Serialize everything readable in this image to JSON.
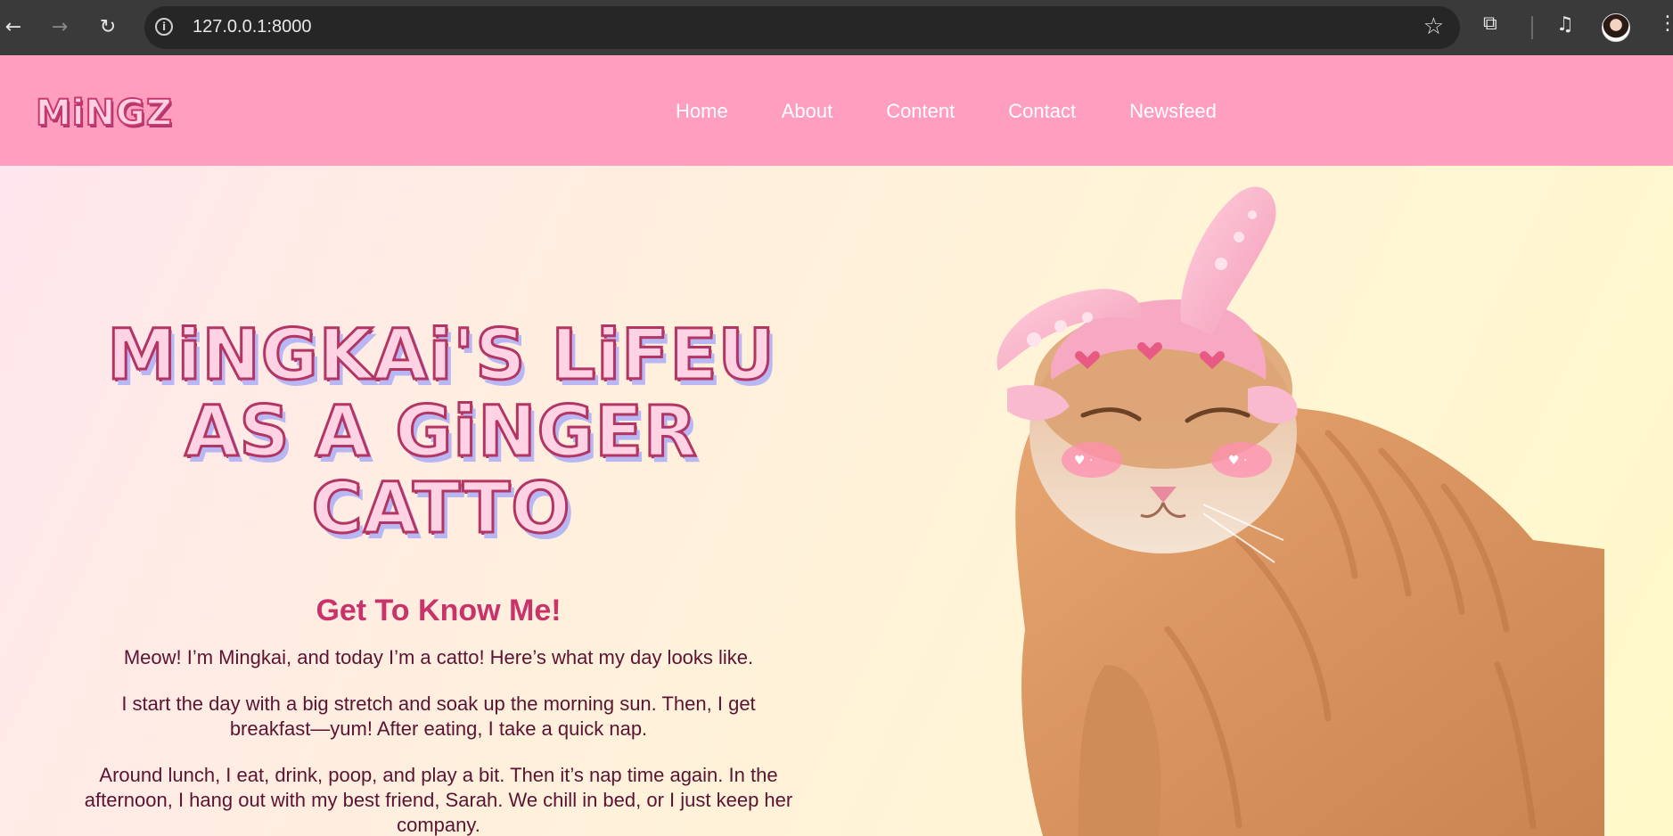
{
  "browser": {
    "url": "127.0.0.1:8000",
    "icons": {
      "back": "back-arrow-icon",
      "forward": "forward-arrow-icon",
      "reload": "reload-icon",
      "site_info": "info-icon",
      "bookmark": "star-icon",
      "extensions": "puzzle-icon",
      "media": "media-queue-icon",
      "profile": "profile-avatar",
      "menu": "kebab-menu-icon"
    }
  },
  "site": {
    "logo": "MiNGZ",
    "nav": [
      "Home",
      "About",
      "Content",
      "Contact",
      "Newsfeed"
    ],
    "colors": {
      "header": "#ff9ebe",
      "heading": "#c8336a",
      "body_text": "#5a1432"
    }
  },
  "hero": {
    "title_line1": "MiNGKAi'S LiFEU",
    "title_line2": "AS A GiNGER CATTO",
    "about_heading": "Get To Know Me!",
    "paragraphs": [
      "Meow! I’m Mingkai, and today I’m a catto! Here’s what my day looks like.",
      "I start the day with a big stretch and soak up the morning sun. Then, I get breakfast—yum! After eating, I take a quick nap.",
      "Around lunch, I eat, drink, poop, and play a bit. Then it’s nap time again. In the afternoon, I hang out with my best friend, Sarah. We chill in bed, or I just keep her company."
    ]
  }
}
